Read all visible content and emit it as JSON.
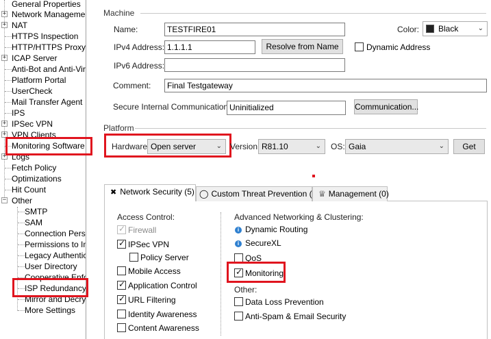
{
  "tree": {
    "items": [
      {
        "label": "General Properties"
      },
      {
        "label": "Network Management"
      },
      {
        "label": "NAT"
      },
      {
        "label": "HTTPS Inspection"
      },
      {
        "label": "HTTP/HTTPS Proxy"
      },
      {
        "label": "ICAP Server"
      },
      {
        "label": "Anti-Bot and Anti-Virus"
      },
      {
        "label": "Platform Portal"
      },
      {
        "label": "UserCheck"
      },
      {
        "label": "Mail Transfer Agent"
      },
      {
        "label": "IPS"
      },
      {
        "label": "IPSec VPN"
      },
      {
        "label": "VPN Clients"
      },
      {
        "label": "Monitoring Software bla"
      },
      {
        "label": "Logs"
      },
      {
        "label": "Fetch Policy"
      },
      {
        "label": "Optimizations"
      },
      {
        "label": "Hit Count"
      },
      {
        "label": "Other"
      },
      {
        "label": "SMTP"
      },
      {
        "label": "SAM"
      },
      {
        "label": "Connection Persist"
      },
      {
        "label": "Permissions to Insta"
      },
      {
        "label": "Legacy Authentica"
      },
      {
        "label": "User Directory"
      },
      {
        "label": "Cooperative Enforc"
      },
      {
        "label": "ISP Redundancy"
      },
      {
        "label": "Mirror and Decrypt"
      },
      {
        "label": "More Settings"
      }
    ]
  },
  "machine": {
    "section_title": "Machine",
    "name_label": "Name:",
    "name_value": "TESTFIRE01",
    "color_label": "Color:",
    "color_value": "Black",
    "ipv4_label": "IPv4 Address:",
    "ipv4_value": "1.1.1.1",
    "resolve_button": "Resolve from Name",
    "dynamic_address_label": "Dynamic Address",
    "ipv6_label": "IPv6 Address:",
    "ipv6_value": "",
    "comment_label": "Comment:",
    "comment_value": "Final Testgateway",
    "sic_label": "Secure Internal Communication:",
    "sic_value": "Uninitialized",
    "communication_button": "Communication..."
  },
  "platform": {
    "section_title": "Platform",
    "hardware_label": "Hardware:",
    "hardware_value": "Open server",
    "version_label": "Version:",
    "version_value": "R81.10",
    "os_label": "OS:",
    "os_value": "Gaia",
    "get_button": "Get"
  },
  "tabs": [
    {
      "label": "Network Security (5)"
    },
    {
      "label": "Custom Threat Prevention (3)"
    },
    {
      "label": "Management (0)"
    }
  ],
  "network_security": {
    "access_control_title": "Access Control:",
    "firewall": "Firewall",
    "ipsec_vpn": "IPSec VPN",
    "policy_server": "Policy Server",
    "mobile_access": "Mobile Access",
    "application_control": "Application Control",
    "url_filtering": "URL Filtering",
    "identity_awareness": "Identity Awareness",
    "content_awareness": "Content Awareness",
    "advanced_title": "Advanced Networking & Clustering:",
    "dynamic_routing": "Dynamic Routing",
    "securexl": "SecureXL",
    "qos": "QoS",
    "monitoring": "Monitoring",
    "other_title": "Other:",
    "dlp": "Data Loss Prevention",
    "antispam": "Anti-Spam & Email Security"
  },
  "colors": {
    "highlight_red": "#e0141e",
    "selection": "#cce8ff",
    "info_blue": "#2f80d0"
  },
  "icons": [
    "expand-plus-icon",
    "collapse-minus-icon",
    "chevron-down-icon",
    "info-icon",
    "shield-icon",
    "crown-icon"
  ]
}
